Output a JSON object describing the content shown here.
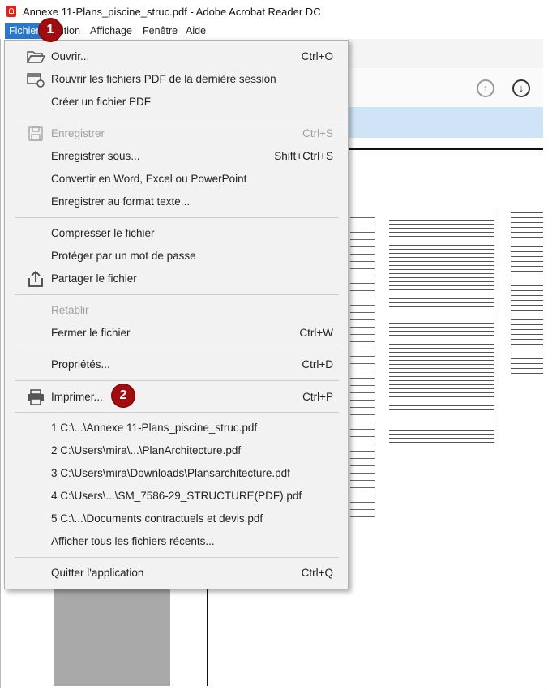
{
  "window": {
    "title": "Annexe 11-Plans_piscine_struc.pdf - Adobe Acrobat Reader DC"
  },
  "menubar": [
    "Fichier",
    "Édition",
    "Affichage",
    "Fenêtre",
    "Aide"
  ],
  "menubar_visible": {
    "fichier": "Fichier",
    "edition_partial": "ition",
    "affichage": "Affichage",
    "fenetre": "Fenêtre",
    "aide": "Aide"
  },
  "file_menu": {
    "ouvrir": {
      "label": "Ouvrir...",
      "shortcut": "Ctrl+O",
      "icon": "folder-open-icon"
    },
    "rouvrir": {
      "label": "Rouvrir les fichiers PDF de la dernière session",
      "icon": "reopen-session-icon"
    },
    "creer": {
      "label": "Créer un fichier PDF"
    },
    "enregistrer": {
      "label": "Enregistrer",
      "shortcut": "Ctrl+S",
      "disabled": true,
      "icon": "save-icon"
    },
    "enregistrer_sous": {
      "label": "Enregistrer sous...",
      "shortcut": "Shift+Ctrl+S"
    },
    "convertir": {
      "label": "Convertir en Word, Excel ou PowerPoint"
    },
    "format_texte": {
      "label": "Enregistrer au format texte..."
    },
    "compresser": {
      "label": "Compresser le fichier"
    },
    "proteger": {
      "label": "Protéger par un mot de passe"
    },
    "partager": {
      "label": "Partager le fichier",
      "icon": "share-icon"
    },
    "retablir": {
      "label": "Rétablir",
      "disabled": true
    },
    "fermer": {
      "label": "Fermer le fichier",
      "shortcut": "Ctrl+W"
    },
    "proprietes": {
      "label": "Propriétés...",
      "shortcut": "Ctrl+D"
    },
    "imprimer": {
      "label": "Imprimer...",
      "shortcut": "Ctrl+P",
      "icon": "printer-icon"
    },
    "recent": [
      "1 C:\\...\\Annexe 11-Plans_piscine_struc.pdf",
      "2 C:\\Users\\mira\\...\\PlanArchitecture.pdf",
      "3 C:\\Users\\mira\\Downloads\\Plansarchitecture.pdf",
      "4 C:\\Users\\...\\SM_7586-29_STRUCTURE(PDF).pdf",
      "5 C:\\...\\Documents contractuels et devis.pdf"
    ],
    "afficher_recents": {
      "label": "Afficher tous les fichiers récents..."
    },
    "quitter": {
      "label": "Quitter l'application",
      "shortcut": "Ctrl+Q"
    }
  },
  "badges": [
    "1",
    "2"
  ],
  "colors": {
    "menu_highlight": "#2b78c9",
    "badge": "#a00d10",
    "accent_blue_band": "#cfe5f7",
    "menu_bg": "#f2f2f2"
  },
  "toolbar": {
    "page_up_icon": "arrow-up-circle-icon",
    "page_down_icon": "arrow-down-circle-icon"
  }
}
